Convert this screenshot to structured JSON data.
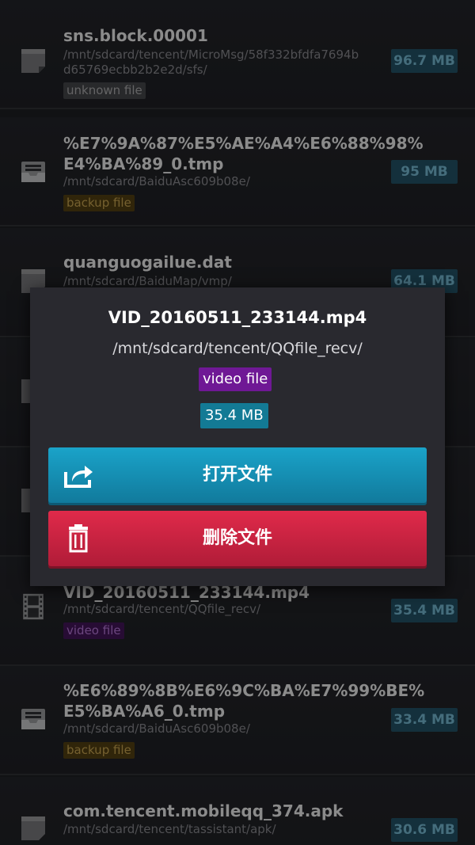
{
  "files": [
    {
      "name": "sns.block.00001",
      "path": "/mnt/sdcard/tencent/MicroMsg/58f332bfdfa7694bd65769ecbb2b2e2d/sfs/",
      "tag": "unknown file",
      "size": "96.7 MB",
      "icon": "blank-file-icon"
    },
    {
      "name": "%E7%9A%87%E5%AE%A4%E6%88%98%E4%BA%89_0.tmp",
      "path": "/mnt/sdcard/BaiduAsc609b08e/",
      "tag": "backup file",
      "size": "95 MB",
      "icon": "archive-tray-icon"
    },
    {
      "name": "quanguogailue.dat",
      "path": "/mnt/sdcard/BaiduMap/vmp/",
      "tag": "",
      "size": "64.1 MB",
      "icon": "blank-file-icon"
    },
    {
      "name": "",
      "path": "",
      "tag": "",
      "size": "",
      "icon": "blank-file-icon"
    },
    {
      "name": "",
      "path": "",
      "tag": "",
      "size": "",
      "icon": "blank-file-icon"
    },
    {
      "name": "VID_20160511_233144.mp4",
      "path": "/mnt/sdcard/tencent/QQfile_recv/",
      "tag": "video file",
      "size": "35.4 MB",
      "icon": "film-strip-icon"
    },
    {
      "name": "%E6%89%8B%E6%9C%BA%E7%99%BE%E5%BA%A6_0.tmp",
      "path": "/mnt/sdcard/BaiduAsc609b08e/",
      "tag": "backup file",
      "size": "33.4 MB",
      "icon": "archive-tray-icon"
    },
    {
      "name": "com.tencent.mobileqq_374.apk",
      "path": "/mnt/sdcard/tencent/tassistant/apk/",
      "tag": "",
      "size": "30.6 MB",
      "icon": "blank-file-icon"
    }
  ],
  "dialog": {
    "title": "VID_20160511_233144.mp4",
    "path": "/mnt/sdcard/tencent/QQfile_recv/",
    "type": "video file",
    "size": "35.4 MB",
    "open_label": "打开文件",
    "delete_label": "删除文件"
  },
  "colors": {
    "open_button": "#1aa3c9",
    "delete_button": "#e02a4a",
    "video_tag": "#6f1895",
    "size_badge": "#137a95"
  }
}
